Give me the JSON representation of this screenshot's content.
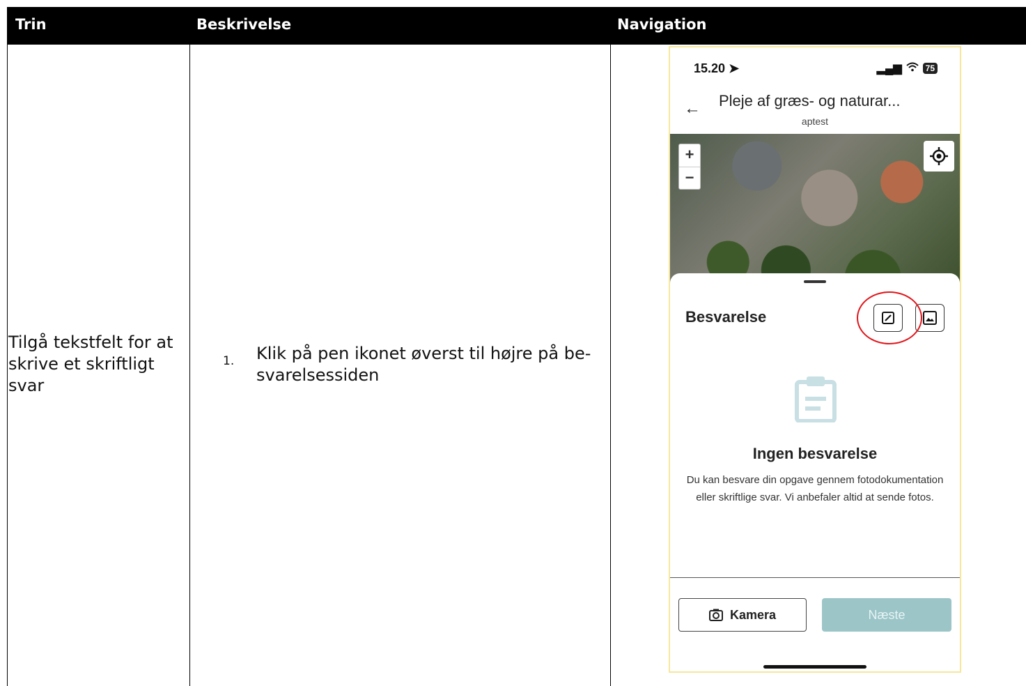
{
  "table": {
    "headers": [
      "Trin",
      "Beskrivelse",
      "Navigation"
    ],
    "row": {
      "trin": "Tilgå tekstfelt for at skrive et skriftligt svar",
      "step_number": "1.",
      "step_text": "Klik på pen ikonet øverst til højre på be-svarelsessiden"
    }
  },
  "phone": {
    "status": {
      "time": "15.20",
      "battery": "75"
    },
    "header": {
      "title": "Pleje af græs- og naturar...",
      "subtitle": "aptest"
    },
    "map": {
      "zoom_in": "+",
      "zoom_out": "−"
    },
    "sheet": {
      "title": "Besvarelse",
      "empty_title": "Ingen besvarelse",
      "empty_text": "Du kan besvare din opgave gennem fotodokumentation eller skriftlige svar. Vi anbefaler altid at sende fotos.",
      "camera_label": "Kamera",
      "next_label": "Næste"
    },
    "colors": {
      "highlight": "#e0161b",
      "next_button": "#9cc5c8",
      "clipboard_icon": "#c8dfe3"
    }
  }
}
